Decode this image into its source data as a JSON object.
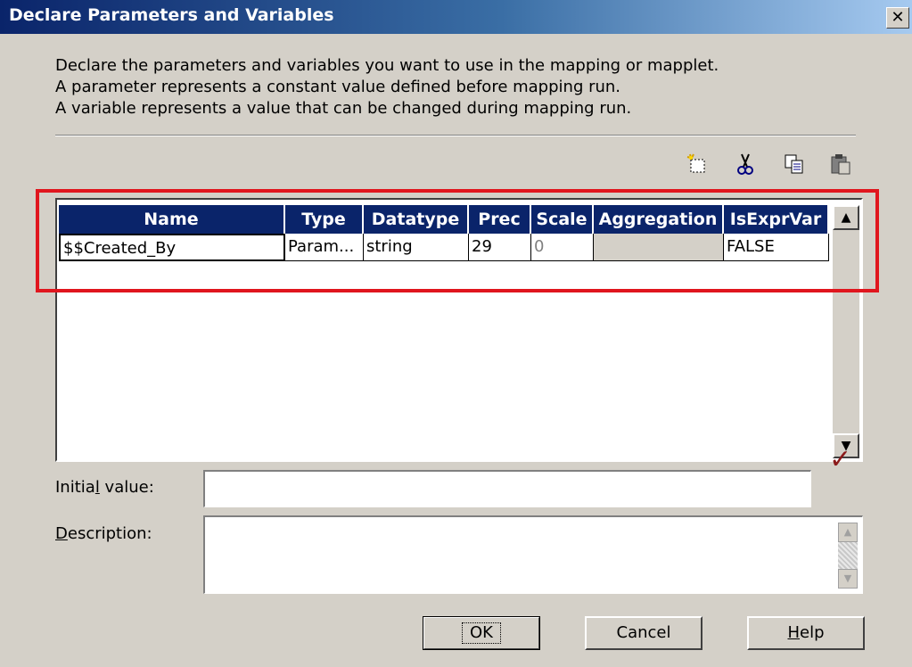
{
  "window": {
    "title": "Declare Parameters and Variables",
    "close_glyph": "✕"
  },
  "intro": {
    "line1": "Declare the parameters and variables you want to use in the mapping or mapplet.",
    "line2": "A parameter represents a constant value defined before mapping run.",
    "line3": "A variable represents a value that can be changed during mapping run."
  },
  "toolbar": {
    "new_icon": "new-icon",
    "cut_icon": "cut-icon",
    "copy_icon": "copy-icon",
    "paste_icon": "paste-icon"
  },
  "grid": {
    "columns": [
      "Name",
      "Type",
      "Datatype",
      "Prec",
      "Scale",
      "Aggregation",
      "IsExprVar"
    ],
    "rows": [
      [
        "$$Created_By",
        "Param...",
        "string",
        "29",
        "0",
        "",
        "FALSE"
      ]
    ]
  },
  "fields": {
    "initial_value_label_pre": "Initia",
    "initial_value_label_u": "l",
    "initial_value_label_post": " value:",
    "initial_value": "",
    "description_label_u": "D",
    "description_label_post": "escription:",
    "description": ""
  },
  "buttons": {
    "ok": "OK",
    "cancel": "Cancel",
    "help_u": "H",
    "help_post": "elp"
  },
  "colors": {
    "highlight": "#e0161e",
    "header_bg": "#0a246a",
    "validate_check": "#8b1a1a"
  }
}
